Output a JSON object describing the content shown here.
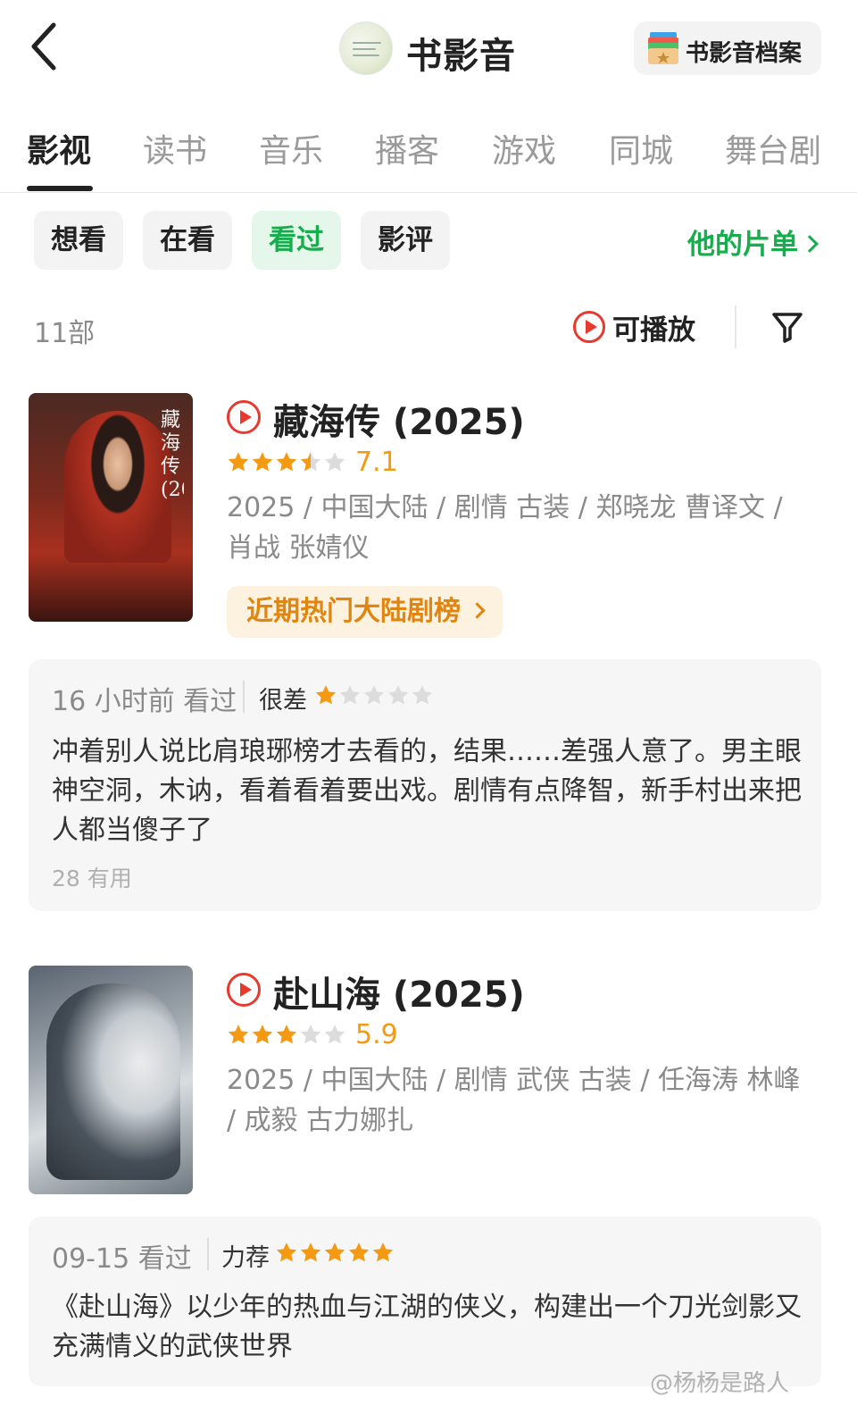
{
  "header": {
    "title": "书影音",
    "archive_label": "书影音档案"
  },
  "tabs": [
    "影视",
    "读书",
    "音乐",
    "播客",
    "游戏",
    "同城",
    "舞台剧"
  ],
  "filters": [
    "想看",
    "在看",
    "看过",
    "影评"
  ],
  "active_filter": "看过",
  "list_link_label": "他的片单",
  "count_label": "11部",
  "playable_label": "可播放",
  "colors": {
    "accent_green": "#17ad4d",
    "play_red": "#e8392f",
    "rating_orange": "#f39a12"
  },
  "movies": [
    {
      "title": "藏海传 (2025)",
      "rating": "7.1",
      "stars_out_of_5": 3.5,
      "meta": "2025 / 中国大陆 / 剧情 古装 / 郑晓龙 曹译文 / 肖战 张婧仪",
      "chart_tag": "近期热门大陆剧榜",
      "review": {
        "time": "16 小时前  看过",
        "verdict": "很差",
        "user_stars": 1,
        "text": "冲着别人说比肩琅琊榜才去看的，结果……差强人意了。男主眼神空洞，木讷，看着看着要出戏。剧情有点降智，新手村出来把人都当傻子了",
        "useful": "28 有用"
      }
    },
    {
      "title": "赴山海 (2025)",
      "rating": "5.9",
      "stars_out_of_5": 3,
      "meta": "2025 / 中国大陆 / 剧情 武侠 古装 / 任海涛 林峰 / 成毅 古力娜扎",
      "review": {
        "time": "09-15  看过",
        "verdict": "力荐",
        "user_stars": 5,
        "text": "《赴山海》以少年的热血与江湖的侠义，构建出一个刀光剑影又充满情义的武侠世界"
      }
    }
  ],
  "watermark": "@杨杨是路人"
}
